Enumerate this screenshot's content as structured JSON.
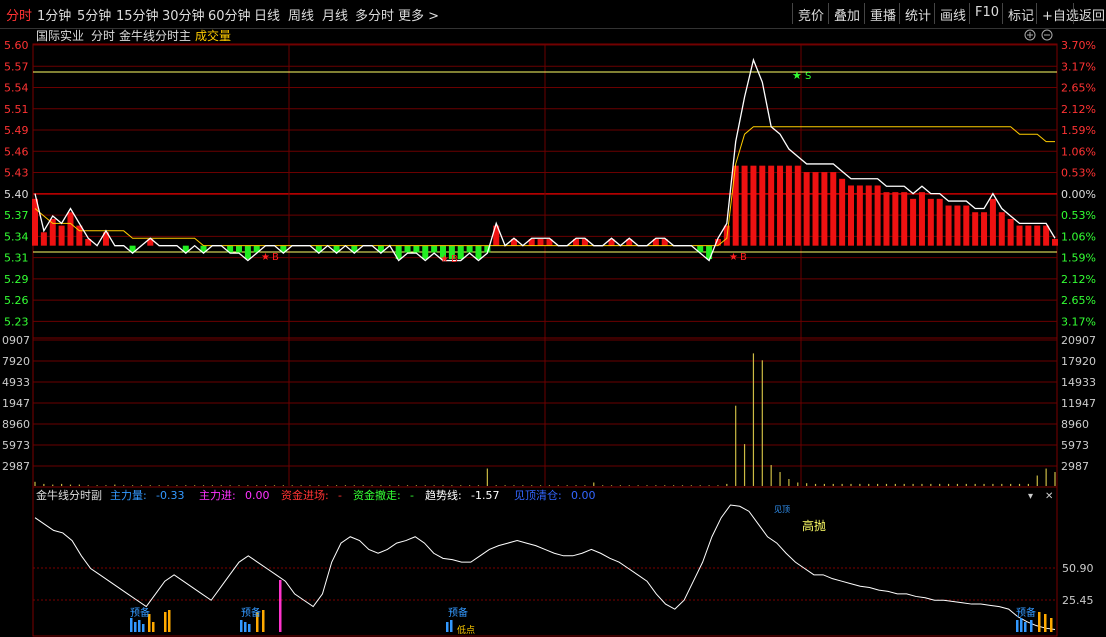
{
  "toolbar": {
    "tabs": [
      "分时",
      "1分钟",
      "5分钟",
      "15分钟",
      "30分钟",
      "60分钟",
      "日线",
      "周线",
      "月线",
      "多分时",
      "更多 >"
    ],
    "active_tab": 0,
    "right_buttons": [
      "竞价",
      "叠加",
      "重播",
      "统计",
      "画线",
      "F10",
      "标记",
      "+自选",
      "返回"
    ]
  },
  "main_panel": {
    "stock_name": "国际实业",
    "mode": "分时",
    "indicator": "金牛线分时主",
    "volume_label": "成交量",
    "price_ticks": [
      "5.60",
      "5.57",
      "5.54",
      "5.51",
      "5.49",
      "5.46",
      "5.43",
      "5.40",
      "5.37",
      "5.34",
      "5.31",
      "5.29",
      "5.26",
      "5.23"
    ],
    "pct_ticks": [
      "3.70%",
      "3.17%",
      "2.65%",
      "2.12%",
      "1.59%",
      "1.06%",
      "0.53%",
      "0.00%",
      "0.53%",
      "1.06%",
      "1.59%",
      "2.12%",
      "2.65%",
      "3.17%"
    ],
    "price_range": [
      5.23,
      5.6
    ],
    "buy_markers": [
      "B",
      "B",
      "B"
    ],
    "sell_marker": "S",
    "colors": {
      "up": "#ff2020",
      "down": "#00ff00",
      "price_line": "#ffffff",
      "avg_line": "#ffcc00",
      "axis_red": "#ff3333"
    }
  },
  "volume_panel": {
    "left_ticks": [
      "0907",
      "7920",
      "4933",
      "1947",
      "8960",
      "5973",
      "2987"
    ],
    "right_ticks": [
      "20907",
      "17920",
      "14933",
      "11947",
      "8960",
      "5973",
      "2987"
    ],
    "max": 20907
  },
  "sub_panel": {
    "title": "金牛线分时副",
    "legend": [
      {
        "label": "主力量:",
        "value": "-0.33",
        "color": "#3399ff"
      },
      {
        "label": "主力进:",
        "value": "0.00",
        "color": "#ff33ff"
      },
      {
        "label": "资金进场:",
        "value": "-",
        "color": "#ff3333"
      },
      {
        "label": "资金撤走:",
        "value": "-",
        "color": "#33ff33"
      },
      {
        "label": "趋势线:",
        "value": "-1.57",
        "color": "#ffffff"
      },
      {
        "label": "见顶清仓:",
        "value": "0.00",
        "color": "#3366ff"
      }
    ],
    "right_ticks": [
      "50.90",
      "25.45"
    ],
    "annotation_high": "高抛",
    "annotation_top": "见顶",
    "annotation_prepare": "预备",
    "annotation_low": "低点"
  },
  "chart_data": {
    "type": "line",
    "prev_close": 5.4,
    "price": [
      5.4,
      5.35,
      5.37,
      5.36,
      5.38,
      5.36,
      5.34,
      5.33,
      5.35,
      5.33,
      5.33,
      5.32,
      5.33,
      5.34,
      5.33,
      5.33,
      5.33,
      5.32,
      5.33,
      5.32,
      5.33,
      5.33,
      5.32,
      5.32,
      5.31,
      5.32,
      5.33,
      5.33,
      5.32,
      5.33,
      5.33,
      5.33,
      5.32,
      5.33,
      5.32,
      5.33,
      5.32,
      5.33,
      5.33,
      5.32,
      5.33,
      5.31,
      5.32,
      5.32,
      5.31,
      5.32,
      5.31,
      5.31,
      5.31,
      5.32,
      5.31,
      5.32,
      5.36,
      5.33,
      5.34,
      5.33,
      5.34,
      5.34,
      5.34,
      5.33,
      5.33,
      5.34,
      5.34,
      5.33,
      5.33,
      5.34,
      5.33,
      5.34,
      5.33,
      5.33,
      5.34,
      5.34,
      5.33,
      5.33,
      5.33,
      5.32,
      5.31,
      5.34,
      5.36,
      5.47,
      5.53,
      5.58,
      5.55,
      5.49,
      5.48,
      5.46,
      5.45,
      5.44,
      5.44,
      5.44,
      5.44,
      5.43,
      5.42,
      5.42,
      5.42,
      5.42,
      5.41,
      5.41,
      5.41,
      5.4,
      5.41,
      5.4,
      5.4,
      5.39,
      5.39,
      5.39,
      5.38,
      5.38,
      5.4,
      5.38,
      5.37,
      5.36,
      5.36,
      5.36,
      5.36,
      5.34
    ],
    "avg": [
      5.38,
      5.37,
      5.36,
      5.36,
      5.36,
      5.35,
      5.35,
      5.35,
      5.35,
      5.35,
      5.35,
      5.34,
      5.34,
      5.34,
      5.34,
      5.34,
      5.34,
      5.34,
      5.34,
      5.33,
      5.33,
      5.33,
      5.33,
      5.33,
      5.33,
      5.33,
      5.33,
      5.33,
      5.33,
      5.33,
      5.33,
      5.33,
      5.33,
      5.33,
      5.33,
      5.33,
      5.33,
      5.33,
      5.33,
      5.33,
      5.33,
      5.33,
      5.33,
      5.33,
      5.33,
      5.33,
      5.33,
      5.33,
      5.33,
      5.33,
      5.33,
      5.33,
      5.33,
      5.33,
      5.33,
      5.33,
      5.33,
      5.33,
      5.33,
      5.33,
      5.33,
      5.33,
      5.33,
      5.33,
      5.33,
      5.33,
      5.33,
      5.33,
      5.33,
      5.33,
      5.33,
      5.33,
      5.33,
      5.33,
      5.33,
      5.33,
      5.33,
      5.33,
      5.34,
      5.44,
      5.48,
      5.49,
      5.49,
      5.49,
      5.49,
      5.49,
      5.49,
      5.49,
      5.49,
      5.49,
      5.49,
      5.49,
      5.49,
      5.49,
      5.49,
      5.49,
      5.49,
      5.49,
      5.49,
      5.49,
      5.49,
      5.49,
      5.49,
      5.49,
      5.49,
      5.49,
      5.49,
      5.49,
      5.49,
      5.49,
      5.49,
      5.48,
      5.48,
      5.48,
      5.47,
      5.47
    ],
    "volume": [
      600,
      300,
      200,
      300,
      200,
      200,
      100,
      100,
      100,
      200,
      100,
      100,
      100,
      100,
      100,
      100,
      100,
      100,
      100,
      100,
      100,
      100,
      100,
      100,
      100,
      100,
      100,
      100,
      100,
      100,
      100,
      100,
      100,
      100,
      100,
      100,
      100,
      100,
      100,
      100,
      100,
      100,
      100,
      100,
      100,
      100,
      100,
      100,
      100,
      100,
      100,
      2500,
      100,
      100,
      100,
      100,
      100,
      100,
      100,
      100,
      100,
      100,
      100,
      500,
      100,
      100,
      100,
      100,
      100,
      100,
      100,
      100,
      100,
      100,
      100,
      100,
      100,
      100,
      300,
      11500,
      6000,
      19000,
      18000,
      3000,
      2000,
      1000,
      500,
      400,
      300,
      300,
      300,
      300,
      300,
      300,
      300,
      300,
      300,
      300,
      300,
      300,
      300,
      300,
      300,
      300,
      300,
      300,
      300,
      300,
      300,
      300,
      300,
      300,
      300,
      1500,
      2500,
      2000
    ],
    "sub_line": [
      90,
      85,
      80,
      78,
      72,
      60,
      50,
      45,
      40,
      35,
      30,
      25,
      20,
      30,
      40,
      45,
      40,
      35,
      30,
      25,
      35,
      45,
      55,
      60,
      55,
      50,
      45,
      40,
      30,
      25,
      20,
      30,
      55,
      70,
      75,
      72,
      65,
      62,
      65,
      70,
      72,
      75,
      70,
      62,
      58,
      57,
      55,
      55,
      60,
      65,
      68,
      70,
      72,
      70,
      68,
      65,
      62,
      60,
      60,
      62,
      65,
      62,
      58,
      55,
      50,
      45,
      40,
      30,
      22,
      18,
      25,
      40,
      55,
      75,
      90,
      100,
      99,
      95,
      85,
      75,
      70,
      62,
      55,
      50,
      45,
      45,
      42,
      40,
      38,
      36,
      35,
      33,
      32,
      30,
      30,
      28,
      27,
      25,
      25,
      24,
      23,
      22,
      22,
      21,
      20,
      18,
      12,
      8,
      5,
      3,
      2
    ]
  }
}
